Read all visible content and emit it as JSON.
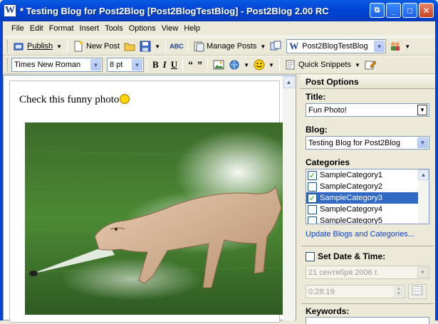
{
  "window": {
    "title": "* Testing Blog for Post2Blog [Post2BlogTestBlog] - Post2Blog 2.00 RC"
  },
  "menu": [
    "File",
    "Edit",
    "Format",
    "Insert",
    "Tools",
    "Options",
    "View",
    "Help"
  ],
  "toolbar": {
    "publish_label": "Publish",
    "new_post_label": "New Post",
    "manage_posts_label": "Manage Posts",
    "blog_select_value": "Post2BlogTestBlog"
  },
  "format_toolbar": {
    "font_value": "Times New Roman",
    "size_value": "8 pt",
    "bold": "B",
    "italic": "I",
    "underline": "U",
    "quick_snippets_label": "Quick Snippets"
  },
  "editor": {
    "text": "Check this funny photo"
  },
  "panel": {
    "header": "Post Options",
    "title_label": "Title:",
    "title_value": "Fun Photo!",
    "blog_label": "Blog:",
    "blog_value": "Testing Blog for Post2Blog",
    "categories_label": "Categories",
    "categories": [
      {
        "name": "SampleCategory1",
        "checked": true,
        "selected": false
      },
      {
        "name": "SampleCategory2",
        "checked": false,
        "selected": false
      },
      {
        "name": "SampleCategory3",
        "checked": true,
        "selected": true
      },
      {
        "name": "SampleCategory4",
        "checked": false,
        "selected": false
      },
      {
        "name": "SampleCategory5",
        "checked": false,
        "selected": false
      }
    ],
    "update_link": "Update Blogs and Categories...",
    "set_date_label": "Set Date & Time:",
    "date_value": "21 сентября 2006 г.",
    "time_value": "0:28:19",
    "keywords_label": "Keywords:"
  },
  "icons": {
    "app": "W",
    "publish": "publish-icon",
    "new_post": "new-post-icon",
    "open": "folder-icon",
    "save": "save-icon",
    "spell": "spellcheck-icon",
    "manage": "manage-posts-icon",
    "blog": "blog-icon",
    "users": "users-icon"
  },
  "colors": {
    "title_bar": "#0046d8",
    "selection": "#316ac5",
    "link": "#0a3fcc"
  }
}
